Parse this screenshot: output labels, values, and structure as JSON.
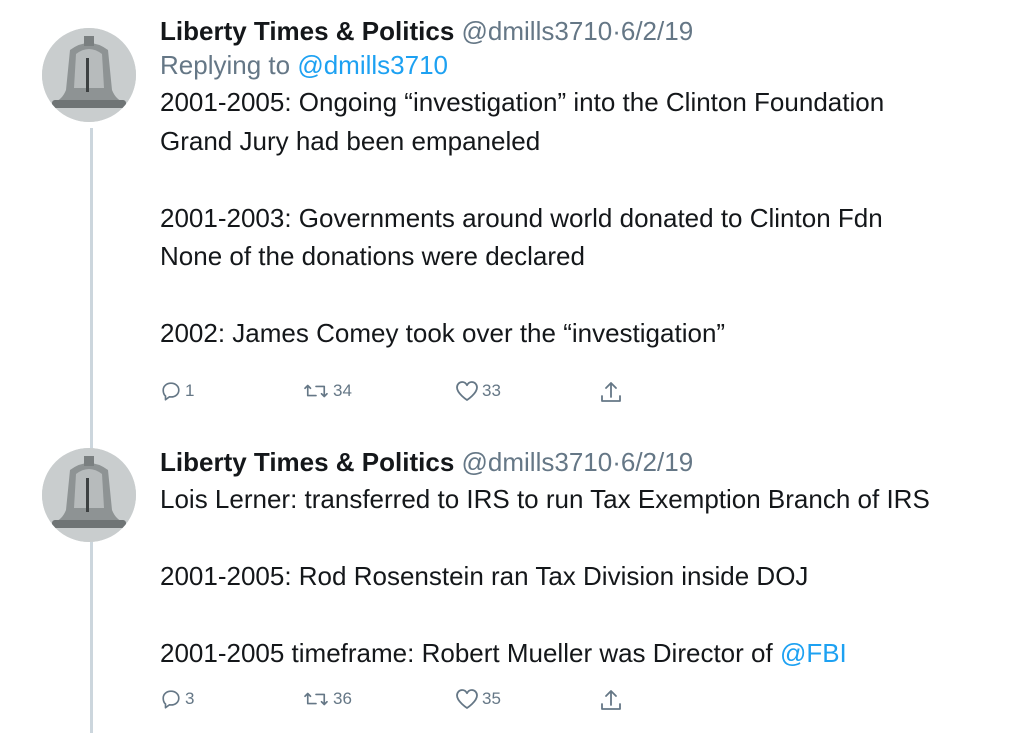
{
  "tweets": [
    {
      "name": "Liberty Times & Politics",
      "handle": "@dmills3710",
      "separator": "·",
      "date": "6/2/19",
      "replying_prefix": "Replying to",
      "replying_to": "@dmills3710",
      "lines": [
        "2001-2005: Ongoing “investigation” into the Clinton Foundation",
        "Grand Jury had been empaneled",
        "",
        "2001-2003: Governments around world donated to Clinton Fdn",
        "None of the donations were declared",
        "",
        "2002: James Comey took over the “investigation”"
      ],
      "actions": {
        "replies": "1",
        "retweets": "34",
        "likes": "33"
      }
    },
    {
      "name": "Liberty Times & Politics",
      "handle": "@dmills3710",
      "separator": "·",
      "date": "6/2/19",
      "lines": [
        "Lois Lerner: transferred to IRS to run Tax Exemption Branch of IRS",
        "",
        "2001-2005: Rod Rosenstein ran Tax Division inside DOJ",
        "",
        "2001-2005 timeframe: Robert Mueller was Director of "
      ],
      "last_line_mention": "@FBI",
      "actions": {
        "replies": "3",
        "retweets": "36",
        "likes": "35"
      }
    }
  ],
  "icons": {
    "reply": "reply-icon",
    "retweet": "retweet-icon",
    "like": "heart-icon",
    "share": "share-icon"
  },
  "colors": {
    "link": "#1da1f2",
    "secondary": "#657786",
    "thread_line": "#ccd6dd"
  }
}
